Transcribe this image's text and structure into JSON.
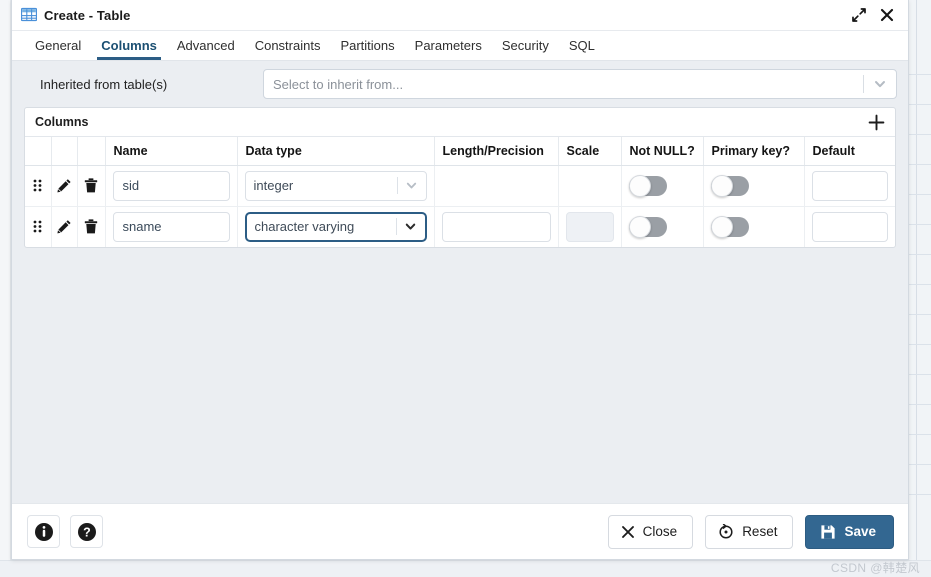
{
  "window": {
    "title": "Create - Table",
    "title_icon": "table-icon",
    "expand_icon": "expand-diagonal-icon",
    "close_icon": "close-icon"
  },
  "tabs": [
    {
      "label": "General",
      "active": false
    },
    {
      "label": "Columns",
      "active": true
    },
    {
      "label": "Advanced",
      "active": false
    },
    {
      "label": "Constraints",
      "active": false
    },
    {
      "label": "Partitions",
      "active": false
    },
    {
      "label": "Parameters",
      "active": false
    },
    {
      "label": "Security",
      "active": false
    },
    {
      "label": "SQL",
      "active": false
    }
  ],
  "inherited": {
    "label": "Inherited from table(s)",
    "value": "",
    "placeholder": "Select to inherit from...",
    "arrow_icon": "chevron-down-icon"
  },
  "columns_panel": {
    "title": "Columns",
    "add_icon": "plus-icon",
    "headers": [
      "",
      "",
      "",
      "Name",
      "Data type",
      "Length/Precision",
      "Scale",
      "Not NULL?",
      "Primary key?",
      "Default"
    ],
    "rows": [
      {
        "drag_icon": "drag-handle-icon",
        "edit_icon": "pencil-icon",
        "delete_icon": "trash-icon",
        "name": "sid",
        "datatype": "integer",
        "datatype_focused": false,
        "length": "",
        "length_visible": false,
        "scale": "",
        "scale_visible": false,
        "scale_disabled": false,
        "not_null": false,
        "primary_key": false,
        "default": ""
      },
      {
        "drag_icon": "drag-handle-icon",
        "edit_icon": "pencil-icon",
        "delete_icon": "trash-icon",
        "name": "sname",
        "datatype": "character varying",
        "datatype_focused": true,
        "length": "",
        "length_visible": true,
        "scale": "",
        "scale_visible": true,
        "scale_disabled": true,
        "not_null": false,
        "primary_key": false,
        "default": ""
      }
    ]
  },
  "footer": {
    "info_label": "i",
    "info_icon": "info-icon",
    "help_icon": "question-icon",
    "close_label": "Close",
    "close_icon": "x-icon",
    "reset_label": "Reset",
    "reset_icon": "reset-arrow-icon",
    "save_label": "Save",
    "save_icon": "floppy-save-icon"
  },
  "watermark": "CSDN @韩楚风",
  "colors": {
    "accent": "#336791",
    "tab_active": "#2c5d85",
    "dialog_bg": "#ebeef2",
    "panel_bg": "#ffffff",
    "toggle_off": "#9a9fa5"
  }
}
